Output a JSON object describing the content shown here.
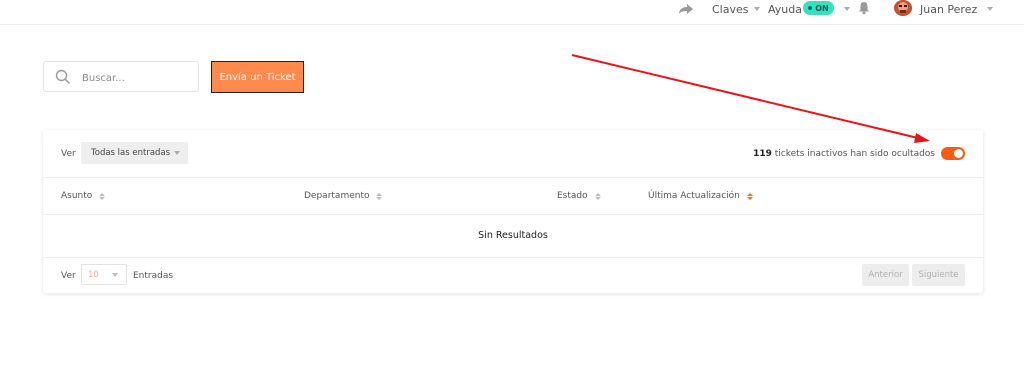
{
  "topbar": {
    "claves_label": "Claves",
    "ayuda_label": "Ayuda",
    "status_badge": "ON",
    "user_name": "Juan Perez",
    "icons": [
      "share-icon",
      "chevron-down-icon",
      "bell-icon",
      "avatar"
    ]
  },
  "search": {
    "placeholder": "Buscar..."
  },
  "actions": {
    "send_ticket_label": "Envía un Ticket"
  },
  "tickets": {
    "ver_label": "Ver",
    "filter_selected": "Todas las entradas",
    "hidden_count": "119",
    "hidden_text": " tickets inactivos han sido ocultados",
    "toggle_on": true,
    "columns": [
      "Asunto",
      "Departamento",
      "Estado",
      "Última Actualización"
    ],
    "empty_message": "Sin Resultados",
    "footer": {
      "ver_label": "Ver",
      "page_size": "10",
      "entries_label": "Entradas",
      "prev_label": "Anterior",
      "next_label": "Siguiente"
    }
  },
  "colors": {
    "accent": "#ff8a4c",
    "toggle": "#ff5a14",
    "badge": "#37e0c0",
    "annotation_arrow": "#e8141a"
  }
}
